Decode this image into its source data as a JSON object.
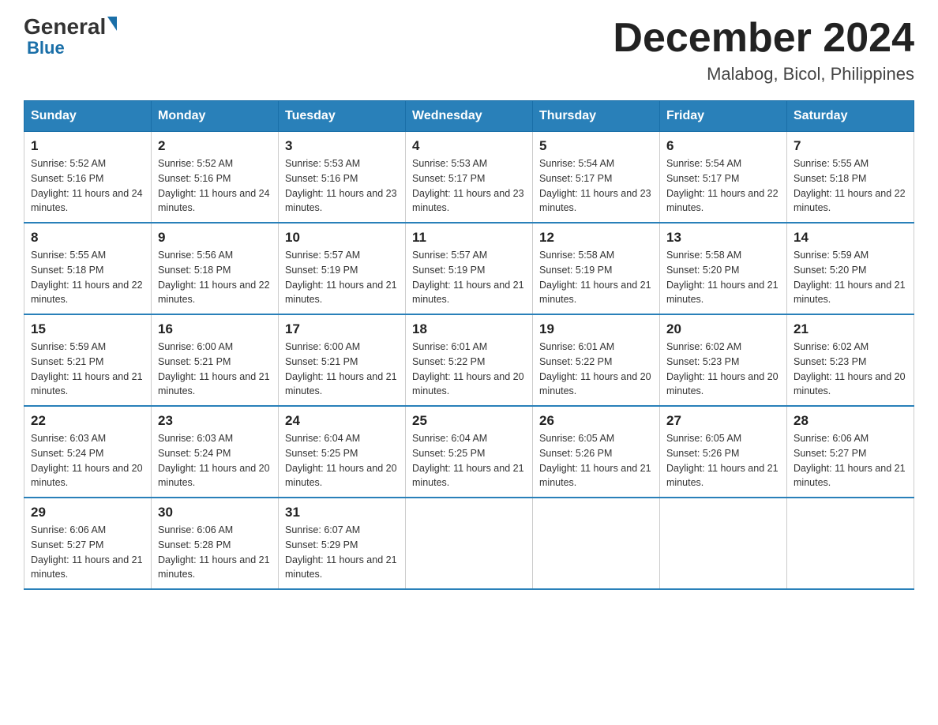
{
  "logo": {
    "general": "General",
    "blue": "Blue"
  },
  "title": "December 2024",
  "subtitle": "Malabog, Bicol, Philippines",
  "days_of_week": [
    "Sunday",
    "Monday",
    "Tuesday",
    "Wednesday",
    "Thursday",
    "Friday",
    "Saturday"
  ],
  "weeks": [
    [
      {
        "day": "1",
        "sunrise": "5:52 AM",
        "sunset": "5:16 PM",
        "daylight": "11 hours and 24 minutes."
      },
      {
        "day": "2",
        "sunrise": "5:52 AM",
        "sunset": "5:16 PM",
        "daylight": "11 hours and 24 minutes."
      },
      {
        "day": "3",
        "sunrise": "5:53 AM",
        "sunset": "5:16 PM",
        "daylight": "11 hours and 23 minutes."
      },
      {
        "day": "4",
        "sunrise": "5:53 AM",
        "sunset": "5:17 PM",
        "daylight": "11 hours and 23 minutes."
      },
      {
        "day": "5",
        "sunrise": "5:54 AM",
        "sunset": "5:17 PM",
        "daylight": "11 hours and 23 minutes."
      },
      {
        "day": "6",
        "sunrise": "5:54 AM",
        "sunset": "5:17 PM",
        "daylight": "11 hours and 22 minutes."
      },
      {
        "day": "7",
        "sunrise": "5:55 AM",
        "sunset": "5:18 PM",
        "daylight": "11 hours and 22 minutes."
      }
    ],
    [
      {
        "day": "8",
        "sunrise": "5:55 AM",
        "sunset": "5:18 PM",
        "daylight": "11 hours and 22 minutes."
      },
      {
        "day": "9",
        "sunrise": "5:56 AM",
        "sunset": "5:18 PM",
        "daylight": "11 hours and 22 minutes."
      },
      {
        "day": "10",
        "sunrise": "5:57 AM",
        "sunset": "5:19 PM",
        "daylight": "11 hours and 21 minutes."
      },
      {
        "day": "11",
        "sunrise": "5:57 AM",
        "sunset": "5:19 PM",
        "daylight": "11 hours and 21 minutes."
      },
      {
        "day": "12",
        "sunrise": "5:58 AM",
        "sunset": "5:19 PM",
        "daylight": "11 hours and 21 minutes."
      },
      {
        "day": "13",
        "sunrise": "5:58 AM",
        "sunset": "5:20 PM",
        "daylight": "11 hours and 21 minutes."
      },
      {
        "day": "14",
        "sunrise": "5:59 AM",
        "sunset": "5:20 PM",
        "daylight": "11 hours and 21 minutes."
      }
    ],
    [
      {
        "day": "15",
        "sunrise": "5:59 AM",
        "sunset": "5:21 PM",
        "daylight": "11 hours and 21 minutes."
      },
      {
        "day": "16",
        "sunrise": "6:00 AM",
        "sunset": "5:21 PM",
        "daylight": "11 hours and 21 minutes."
      },
      {
        "day": "17",
        "sunrise": "6:00 AM",
        "sunset": "5:21 PM",
        "daylight": "11 hours and 21 minutes."
      },
      {
        "day": "18",
        "sunrise": "6:01 AM",
        "sunset": "5:22 PM",
        "daylight": "11 hours and 20 minutes."
      },
      {
        "day": "19",
        "sunrise": "6:01 AM",
        "sunset": "5:22 PM",
        "daylight": "11 hours and 20 minutes."
      },
      {
        "day": "20",
        "sunrise": "6:02 AM",
        "sunset": "5:23 PM",
        "daylight": "11 hours and 20 minutes."
      },
      {
        "day": "21",
        "sunrise": "6:02 AM",
        "sunset": "5:23 PM",
        "daylight": "11 hours and 20 minutes."
      }
    ],
    [
      {
        "day": "22",
        "sunrise": "6:03 AM",
        "sunset": "5:24 PM",
        "daylight": "11 hours and 20 minutes."
      },
      {
        "day": "23",
        "sunrise": "6:03 AM",
        "sunset": "5:24 PM",
        "daylight": "11 hours and 20 minutes."
      },
      {
        "day": "24",
        "sunrise": "6:04 AM",
        "sunset": "5:25 PM",
        "daylight": "11 hours and 20 minutes."
      },
      {
        "day": "25",
        "sunrise": "6:04 AM",
        "sunset": "5:25 PM",
        "daylight": "11 hours and 21 minutes."
      },
      {
        "day": "26",
        "sunrise": "6:05 AM",
        "sunset": "5:26 PM",
        "daylight": "11 hours and 21 minutes."
      },
      {
        "day": "27",
        "sunrise": "6:05 AM",
        "sunset": "5:26 PM",
        "daylight": "11 hours and 21 minutes."
      },
      {
        "day": "28",
        "sunrise": "6:06 AM",
        "sunset": "5:27 PM",
        "daylight": "11 hours and 21 minutes."
      }
    ],
    [
      {
        "day": "29",
        "sunrise": "6:06 AM",
        "sunset": "5:27 PM",
        "daylight": "11 hours and 21 minutes."
      },
      {
        "day": "30",
        "sunrise": "6:06 AM",
        "sunset": "5:28 PM",
        "daylight": "11 hours and 21 minutes."
      },
      {
        "day": "31",
        "sunrise": "6:07 AM",
        "sunset": "5:29 PM",
        "daylight": "11 hours and 21 minutes."
      },
      null,
      null,
      null,
      null
    ]
  ]
}
